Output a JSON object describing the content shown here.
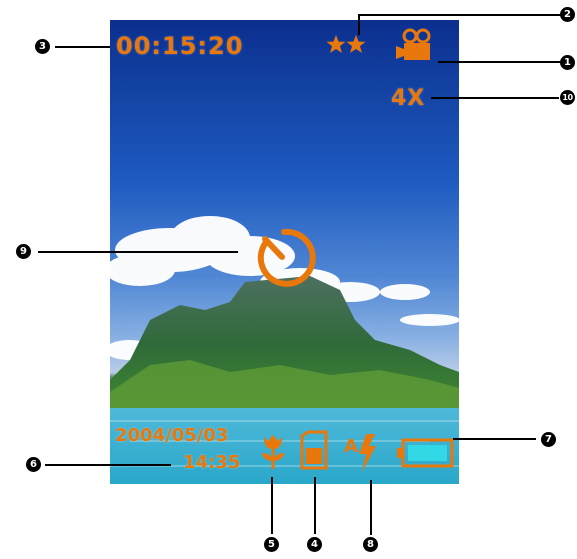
{
  "screen": {
    "recording_time": "00:15:20",
    "zoom_level": "4X",
    "date": "2004/05/03",
    "time": "14:35",
    "quality_stars": 2,
    "battery_level": 1.0,
    "icons": {
      "mode": "video-camera-icon",
      "quality": "star-icon",
      "self_timer": "self-timer-icon",
      "macro": "macro-flower-icon",
      "memory": "sd-card-icon",
      "flash": "auto-flash-icon",
      "battery": "battery-icon"
    }
  },
  "callouts": {
    "c1": "1",
    "c2": "2",
    "c3": "3",
    "c4": "4",
    "c5": "5",
    "c6": "6",
    "c7": "7",
    "c8": "8",
    "c9": "9",
    "c10": "10"
  },
  "colors": {
    "osd": "#e8780c",
    "battery_fill": "#33d8e6"
  }
}
